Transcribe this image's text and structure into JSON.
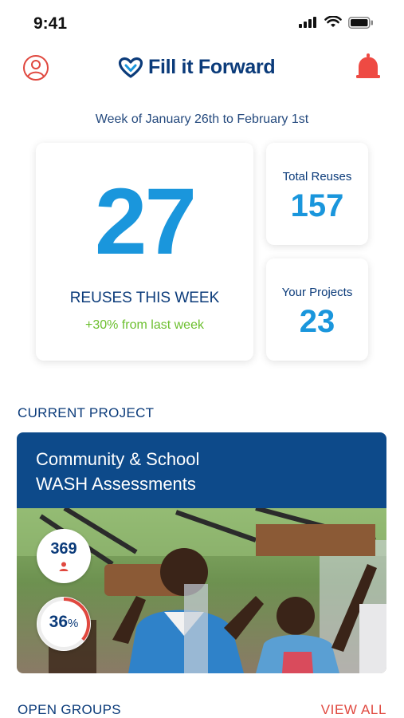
{
  "status_bar": {
    "time": "9:41"
  },
  "header": {
    "brand_name": "Fill it Forward",
    "brand_color": "#0b3b7a",
    "alert_color": "#ee4a43"
  },
  "week": {
    "label": "Week of January 26th to February 1st"
  },
  "stats": {
    "reuses_this_week": "27",
    "reuses_label": "REUSES THIS WEEK",
    "change": "+30% from last week",
    "total_reuses_label": "Total Reuses",
    "total_reuses": "157",
    "projects_label": "Your Projects",
    "projects": "23"
  },
  "current_project": {
    "section_title": "CURRENT PROJECT",
    "title_line1": "Community & School",
    "title_line2": "WASH Assessments",
    "members": "369",
    "progress_value": "36",
    "progress_unit": "%",
    "progress_fraction": 0.36
  },
  "open_groups": {
    "section_title": "OPEN GROUPS",
    "view_all": "VIEW ALL"
  },
  "colors": {
    "accent_blue": "#1a96dc",
    "navy": "#0b3b7a",
    "green": "#6cbf2e",
    "red": "#e0483f"
  }
}
